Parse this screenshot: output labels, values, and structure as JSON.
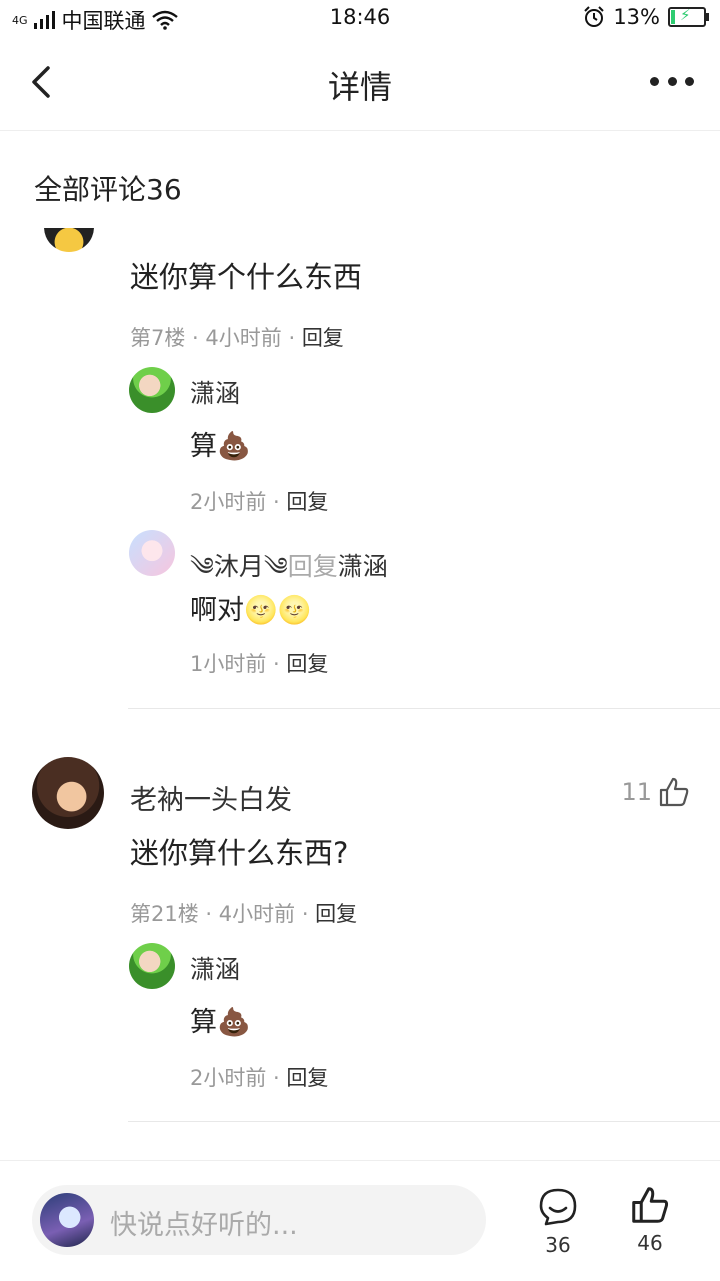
{
  "status": {
    "network": "4G",
    "carrier": "中国联通",
    "time": "18:46",
    "battery_text": "13%"
  },
  "nav": {
    "title": "详情"
  },
  "section_title": "全部评论36",
  "comments": [
    {
      "text": "迷你算个什么东西",
      "floor": "第7楼",
      "time": "4小时前",
      "reply_label": "回复",
      "replies": [
        {
          "name": "潇涵",
          "text": "算💩",
          "time": "2小时前",
          "reply_label": "回复"
        },
        {
          "name": "༄沐月༄",
          "reply_word": "回复",
          "target": "潇涵",
          "text": "啊对🌝🌝",
          "time": "1小时前",
          "reply_label": "回复"
        }
      ]
    },
    {
      "name": "老衲一头白发",
      "text": "迷你算什么东西?",
      "floor": "第21楼",
      "time": "4小时前",
      "reply_label": "回复",
      "likes": "11",
      "replies": [
        {
          "name": "潇涵",
          "text": "算💩",
          "time": "2小时前",
          "reply_label": "回复"
        }
      ]
    }
  ],
  "bottom": {
    "placeholder": "快说点好听的...",
    "comment_count": "36",
    "like_count": "46"
  },
  "icons": [
    "back-icon",
    "more-icon",
    "wifi-icon",
    "alarm-icon",
    "battery-icon",
    "like-icon",
    "comment-icon"
  ]
}
